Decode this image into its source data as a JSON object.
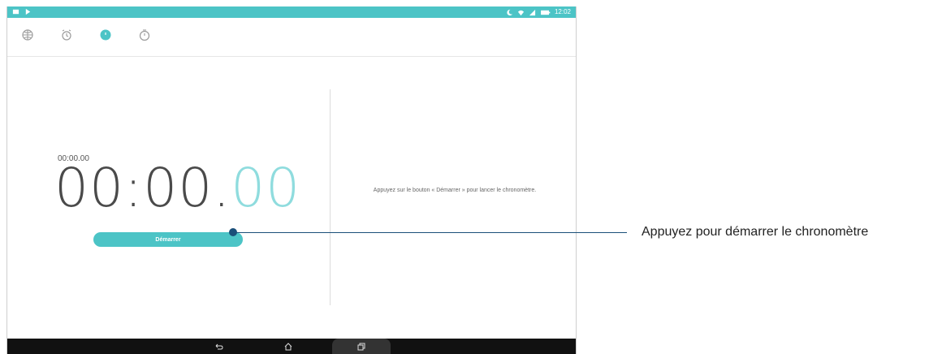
{
  "status_bar": {
    "time": "12:02"
  },
  "tabs": [
    {
      "name": "tab-world-clock",
      "icon": "globe-icon"
    },
    {
      "name": "tab-alarm",
      "icon": "alarm-icon"
    },
    {
      "name": "tab-stopwatch",
      "icon": "stopwatch-icon",
      "active": true
    },
    {
      "name": "tab-timer",
      "icon": "timer-icon"
    }
  ],
  "stopwatch": {
    "lap_time": "00:00.00",
    "main_time": "00:00.",
    "hundredths": "00",
    "start_label": "Démarrer"
  },
  "hint_text": "Appuyez sur le bouton « Démarrer » pour lancer le chronomètre.",
  "nav": {
    "back": "back-icon",
    "home": "home-icon",
    "recent": "recent-apps-icon"
  },
  "callout": {
    "text": "Appuyez pour démarrer le chronomètre"
  },
  "colors": {
    "accent": "#4cc4c6",
    "accent_light": "#8fdcde",
    "callout": "#1a4f79",
    "nav": "#111111"
  }
}
